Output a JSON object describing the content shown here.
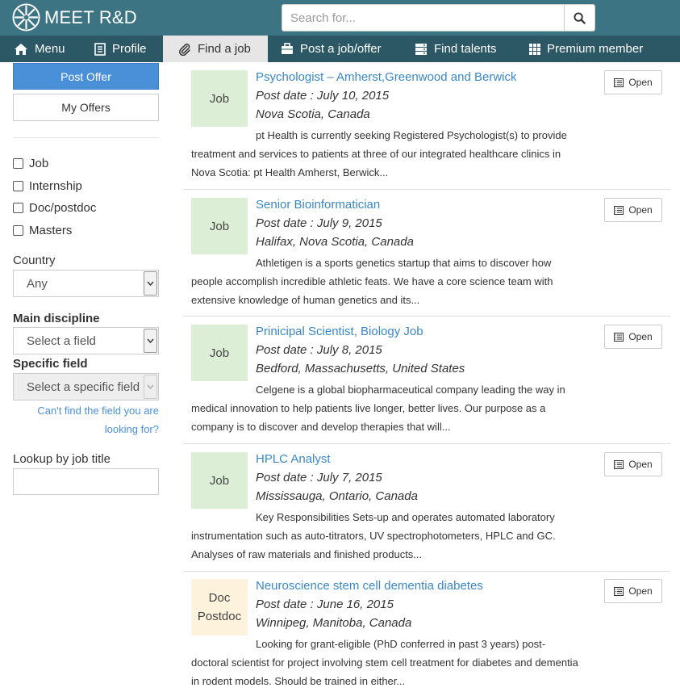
{
  "app": {
    "logo_text": "MEET R&D"
  },
  "search": {
    "placeholder": "Search for..."
  },
  "nav": {
    "menu": "Menu",
    "profile": "Profile",
    "find_job": "Find a job",
    "post_job": "Post a job/offer",
    "find_talents": "Find talents",
    "premium": "Premium member"
  },
  "sidebar": {
    "post_offer": "Post Offer",
    "my_offers": "My Offers",
    "types": [
      "Job",
      "Internship",
      "Doc/postdoc",
      "Masters"
    ],
    "country_label": "Country",
    "country_value": "Any",
    "discipline_label": "Main discipline",
    "discipline_value": "Select a field",
    "specific_label": "Specific field",
    "specific_value": "Select a specific field",
    "cant_find_line1": "Can't find the field you are",
    "cant_find_line2": "looking for?",
    "lookup_label": "Lookup by job title"
  },
  "listings": [
    {
      "badge_line1": "Job",
      "badge_line2": "",
      "title": "Psychologist – Amherst,Greenwood and Berwick",
      "post_date": "Post date : July 10, 2015",
      "location": "Nova Scotia, Canada",
      "description": "pt Health is currently seeking Registered Psychologist(s) to provide treatment and services to patients at three of our integrated healthcare clinics in Nova Scotia: pt Health Amherst, Berwick...",
      "open": "Open"
    },
    {
      "badge_line1": "Job",
      "badge_line2": "",
      "title": "Senior Bioinformatician",
      "post_date": "Post date : July 9, 2015",
      "location": "Halifax, Nova Scotia, Canada",
      "description": "Athletigen is a sports genetics startup that aims to discover how people accomplish incredible athletic feats. We have a core science team with extensive knowledge of human genetics and its...",
      "open": "Open"
    },
    {
      "badge_line1": "Job",
      "badge_line2": "",
      "title": "Prinicipal Scientist, Biology Job",
      "post_date": "Post date : July 8, 2015",
      "location": "Bedford, Massachusetts, United States",
      "description": "Celgene is a global biopharmaceutical company leading the way in medical innovation to help patients live longer, better lives. Our purpose as a company is to discover and develop therapies that will...",
      "open": "Open"
    },
    {
      "badge_line1": "Job",
      "badge_line2": "",
      "title": "HPLC Analyst",
      "post_date": "Post date : July 7, 2015",
      "location": "Mississauga, Ontario, Canada",
      "description": "Key Responsibilities Sets-up and operates automated laboratory instrumentation such as auto-titrators, UV spectrophotometers, HPLC and GC. Analyses of raw materials and finished products...",
      "open": "Open"
    },
    {
      "badge_line1": "Doc",
      "badge_line2": "Postdoc",
      "title": "Neuroscience stem cell dementia diabetes",
      "post_date": "Post date : June 16, 2015",
      "location": "Winnipeg, Manitoba, Canada",
      "description": "Looking for grant-eligible (PhD conferred in past 3 years) post-doctoral scientist for project involving stem cell treatment for diabetes and dementia in rodent models. Should be trained in either...",
      "open": "Open"
    }
  ],
  "colors": {
    "header": "#3d7484",
    "nav": "#2c5764",
    "primary_button": "#4a90d9",
    "link": "#3a87c8",
    "job_badge": "#dcefd6",
    "doc_badge": "#fdf3dc"
  },
  "icons": {
    "logo": "sunburst-logo-icon",
    "search": "search-icon",
    "menu": "home-icon",
    "profile": "document-icon",
    "find_job": "paperclip-icon",
    "post_job": "briefcase-icon",
    "find_talents": "server-icon",
    "premium": "grid-icon",
    "open": "list-icon"
  }
}
